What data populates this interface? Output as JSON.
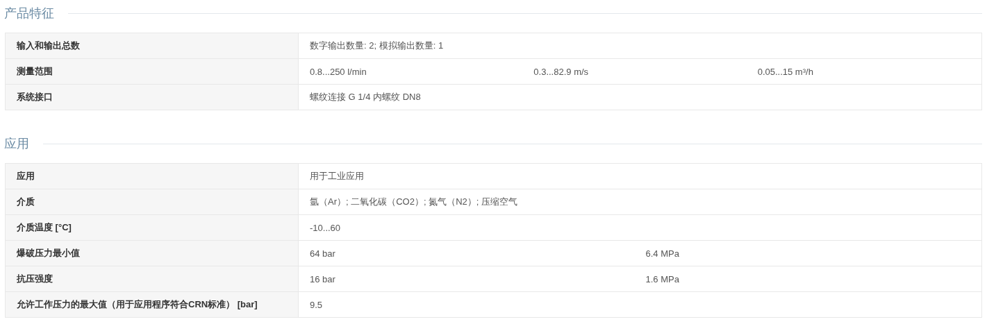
{
  "sections": [
    {
      "title": "产品特征",
      "rows": [
        {
          "label": "输入和输出总数",
          "values": [
            "数字输出数量: 2; 模拟输出数量: 1"
          ]
        },
        {
          "label": "测量范围",
          "values": [
            "0.8...250 l/min",
            "0.3...82.9 m/s",
            "0.05...15 m³/h"
          ]
        },
        {
          "label": "系统接口",
          "values": [
            "螺纹连接 G 1/4 内螺纹 DN8"
          ]
        }
      ]
    },
    {
      "title": "应用",
      "rows": [
        {
          "label": "应用",
          "values": [
            "用于工业应用"
          ]
        },
        {
          "label": "介质",
          "values": [
            "氩（Ar）; 二氧化碳（CO2）; 氮气（N2）; 压缩空气"
          ]
        },
        {
          "label": "介质温度 [°C]",
          "values": [
            "-10...60"
          ]
        },
        {
          "label": "爆破压力最小值",
          "values": [
            "64 bar",
            "6.4 MPa"
          ]
        },
        {
          "label": "抗压强度",
          "values": [
            "16 bar",
            "1.6 MPa"
          ]
        },
        {
          "label": "允许工作压力的最大值（用于应用程序符合CRN标准） [bar]",
          "values": [
            "9.5"
          ]
        }
      ]
    }
  ]
}
